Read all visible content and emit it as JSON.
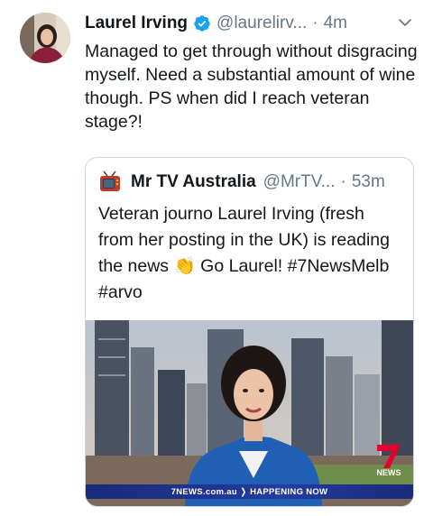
{
  "tweet": {
    "name": "Laurel Irving",
    "handle": "@laurelirv...",
    "separator": "·",
    "time": "4m",
    "text": "Managed to get through without disgracing myself. Need a substantial amount of wine though.  PS when did I reach veteran stage?!"
  },
  "quoted": {
    "name": "Mr TV Australia",
    "handle": "@MrTV...",
    "separator": "·",
    "time": "53m",
    "text_before": "Veteran journo Laurel Irving (fresh from her posting in the UK) is reading the news ",
    "emoji": "👏",
    "text_after": " Go Laurel! #7NewsMelb #arvo"
  },
  "media": {
    "ticker": "7NEWS.com.au ❭ HAPPENING NOW",
    "channel_logo_text": "NEWS"
  },
  "colors": {
    "verified": "#1da1f2",
    "secondary_text": "#657786",
    "border": "#ccd6dd",
    "channel_red": "#e4002b"
  }
}
